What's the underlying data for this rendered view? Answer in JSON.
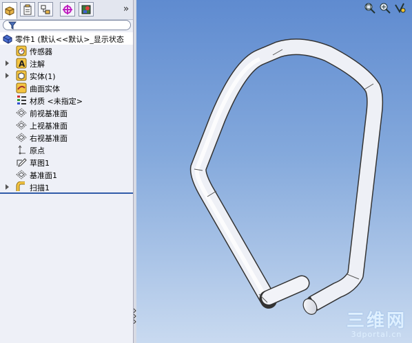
{
  "panel": {
    "tabs": [
      {
        "name": "featuremanager-tab",
        "icon": "feature-tree-icon"
      },
      {
        "name": "propertymanager-tab",
        "icon": "property-icon"
      },
      {
        "name": "configurationmanager-tab",
        "icon": "configuration-icon"
      },
      {
        "name": "dimxpert-tab",
        "icon": "crosshair-icon"
      },
      {
        "name": "display-manager-tab",
        "icon": "appearance-icon"
      }
    ],
    "more_label": "»",
    "filter_icon": "filter-icon"
  },
  "tree": {
    "root": "零件1 (默认<<默认>_显示状态",
    "items": [
      {
        "label": "传感器",
        "icon": "sensor-icon",
        "expandable": false
      },
      {
        "label": "注解",
        "icon": "annotation-icon",
        "expandable": true
      },
      {
        "label": "实体(1)",
        "icon": "solid-bodies-icon",
        "expandable": true
      },
      {
        "label": "曲面实体",
        "icon": "surface-bodies-icon",
        "expandable": false
      },
      {
        "label": "材质 <未指定>",
        "icon": "material-icon",
        "expandable": false
      },
      {
        "label": "前视基准面",
        "icon": "plane-icon",
        "expandable": false
      },
      {
        "label": "上视基准面",
        "icon": "plane-icon",
        "expandable": false
      },
      {
        "label": "右视基准面",
        "icon": "plane-icon",
        "expandable": false
      },
      {
        "label": "原点",
        "icon": "origin-icon",
        "expandable": false
      },
      {
        "label": "草图1",
        "icon": "sketch-icon",
        "expandable": false
      },
      {
        "label": "基准面1",
        "icon": "plane-icon",
        "expandable": false
      },
      {
        "label": "扫描1",
        "icon": "sweep-icon",
        "expandable": true
      }
    ]
  },
  "viewport_tools": [
    "zoom-to-fit-icon",
    "zoom-area-icon",
    "previous-view-icon"
  ],
  "watermark": {
    "main": "三维网",
    "sub": "3dportal.cn"
  },
  "colors": {
    "panel_bg": "#eef0f7",
    "viewport_top": "#5f8bd0",
    "viewport_bottom": "#c9daf0",
    "rollback_bar": "#2e5aa8"
  }
}
